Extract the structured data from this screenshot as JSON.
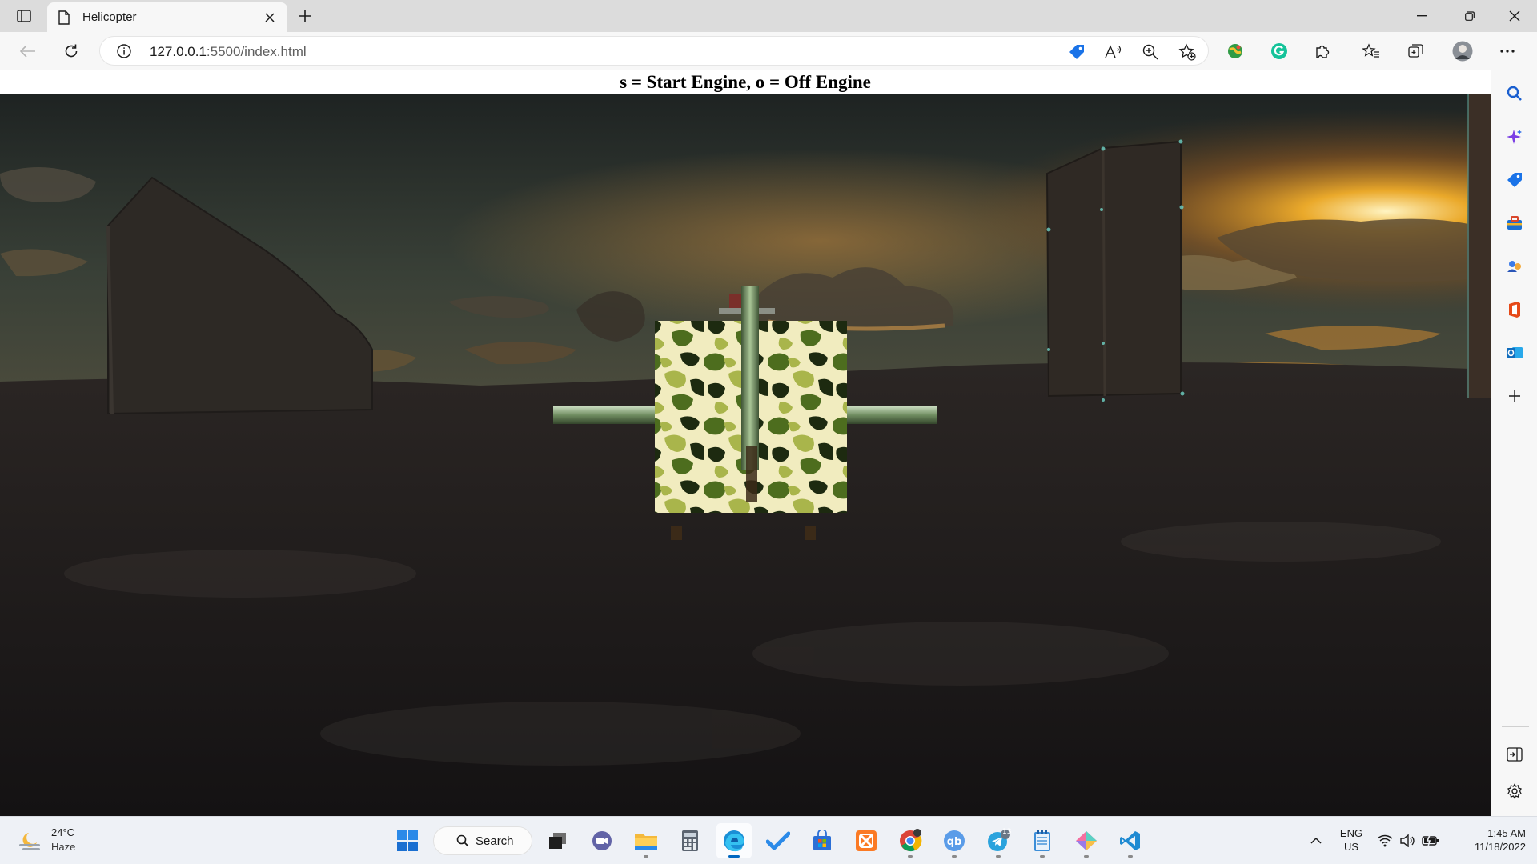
{
  "browser": {
    "tab": {
      "title": "Helicopter"
    },
    "address": {
      "host": "127.0.0.1",
      "path": ":5500/index.html"
    }
  },
  "page": {
    "heading": "s = Start Engine, o = Off Engine"
  },
  "taskbar": {
    "weather": {
      "temperature": "24°C",
      "condition": "Haze"
    },
    "search_label": "Search",
    "telegram_badge": "13",
    "language": {
      "line1": "ENG",
      "line2": "US"
    },
    "clock": {
      "time": "1:45 AM",
      "date": "11/18/2022"
    }
  },
  "colors": {
    "accent": "#0067c0",
    "titlebar": "#dcdcdc",
    "toolbar": "#f7f7f7"
  }
}
